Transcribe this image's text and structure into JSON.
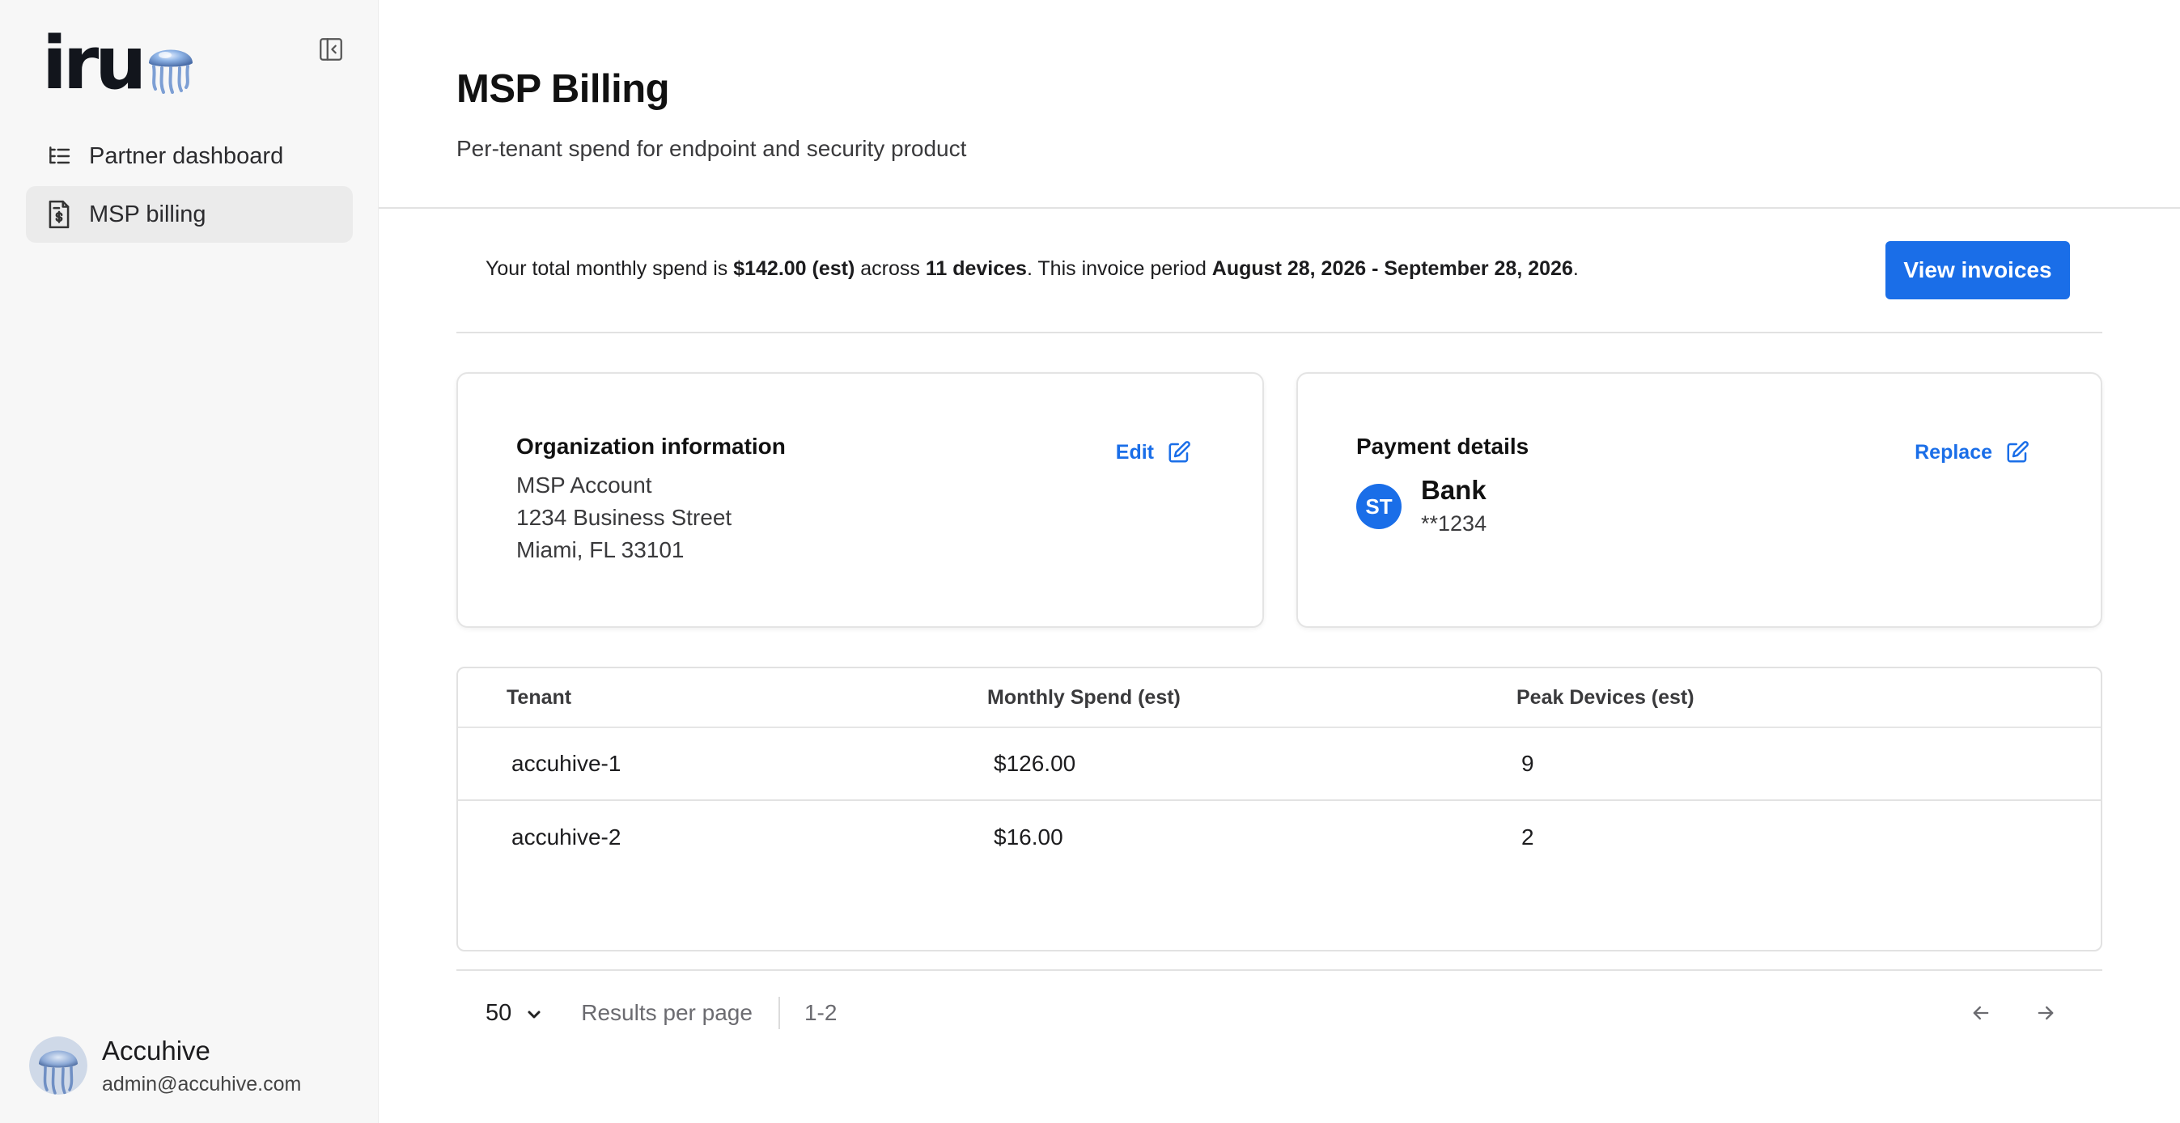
{
  "brand": {
    "logo_text": "iru"
  },
  "sidebar": {
    "items": [
      {
        "label": "Partner dashboard",
        "icon": "list-tree-icon",
        "active": false
      },
      {
        "label": "MSP billing",
        "icon": "invoice-dollar-icon",
        "active": true
      }
    ]
  },
  "user": {
    "name": "Accuhive",
    "email": "admin@accuhive.com"
  },
  "page": {
    "title": "MSP Billing",
    "subtitle": "Per-tenant spend for endpoint and security product"
  },
  "summary": {
    "prefix": "Your total monthly spend is ",
    "total": "$142.00 (est)",
    "across": " across ",
    "devices": "11 devices",
    "period_prefix": ". This invoice period ",
    "period": "August 28, 2026 - September 28, 2026",
    "suffix": ".",
    "button": "View invoices"
  },
  "org_card": {
    "title": "Organization information",
    "action": "Edit",
    "lines": [
      "MSP Account",
      "1234 Business Street",
      "Miami, FL 33101"
    ]
  },
  "payment_card": {
    "title": "Payment details",
    "action": "Replace",
    "badge": "ST",
    "method": "Bank",
    "number": "**1234"
  },
  "table": {
    "headers": [
      "Tenant",
      "Monthly Spend (est)",
      "Peak Devices (est)"
    ],
    "rows": [
      [
        "accuhive-1",
        "$126.00",
        "9"
      ],
      [
        "accuhive-2",
        "$16.00",
        "2"
      ]
    ]
  },
  "pagination": {
    "per_page": "50",
    "per_page_label": "Results per page",
    "range": "1-2"
  },
  "colors": {
    "accent": "#1a6ee8",
    "sidebar_bg": "#f7f7f7",
    "active_item_bg": "#ebebeb"
  }
}
